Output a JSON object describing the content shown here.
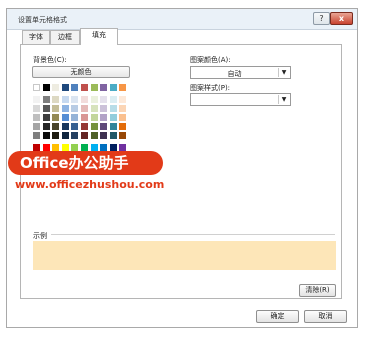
{
  "dialog": {
    "title": "设置单元格格式",
    "help_label": "?",
    "close_label": "x"
  },
  "tabs": [
    {
      "label": "字体"
    },
    {
      "label": "边框"
    },
    {
      "label": "填充"
    }
  ],
  "fill": {
    "bg_color_label": "背景色(C):",
    "no_color_label": "无颜色",
    "pattern_color_label": "图案颜色(A):",
    "pattern_color_value": "自动",
    "pattern_style_label": "图案样式(P):",
    "pattern_style_value": "",
    "sample_label": "示例",
    "sample_color": "#fde6b8",
    "selected_swatch": "#fde6b8",
    "palette": [
      [
        "#ffffff",
        "#000000",
        "#eeece1",
        "#1f497d",
        "#4f81bd",
        "#c0504d",
        "#9bbb59",
        "#8064a2",
        "#4bacc6",
        "#f79646"
      ],
      [
        "#f2f2f2",
        "#7f7f7f",
        "#ddd9c3",
        "#c6d9f0",
        "#dbe5f1",
        "#f2dcdb",
        "#ebf1dd",
        "#e5e0ec",
        "#dbeef3",
        "#fde9d9"
      ],
      [
        "#d8d8d8",
        "#595959",
        "#c4bd97",
        "#8db3e2",
        "#b8cce4",
        "#e5b9b7",
        "#d7e3bc",
        "#ccc1d9",
        "#b7dde8",
        "#fbd5b5"
      ],
      [
        "#bfbfbf",
        "#3f3f3f",
        "#938953",
        "#548dd4",
        "#95b3d7",
        "#d99694",
        "#c3d69b",
        "#b2a2c7",
        "#92cddc",
        "#fac08f"
      ],
      [
        "#a5a5a5",
        "#262626",
        "#494429",
        "#17365d",
        "#366092",
        "#953734",
        "#76923c",
        "#5f497a",
        "#31859b",
        "#e36c09"
      ],
      [
        "#7f7f7f",
        "#0c0c0c",
        "#1d1b10",
        "#0f243e",
        "#244061",
        "#632423",
        "#4f6128",
        "#3f3151",
        "#205867",
        "#974806"
      ]
    ],
    "standard_colors": [
      "#c00000",
      "#ff0000",
      "#ffc000",
      "#ffff00",
      "#92d050",
      "#00b050",
      "#00b0f0",
      "#0070c0",
      "#002060",
      "#7030a0"
    ]
  },
  "buttons": {
    "clear_label": "清除(R)",
    "ok_label": "确定",
    "cancel_label": "取消"
  },
  "watermark": {
    "logo_text": "Office办公助手",
    "url": "www.officezhushou.com"
  }
}
